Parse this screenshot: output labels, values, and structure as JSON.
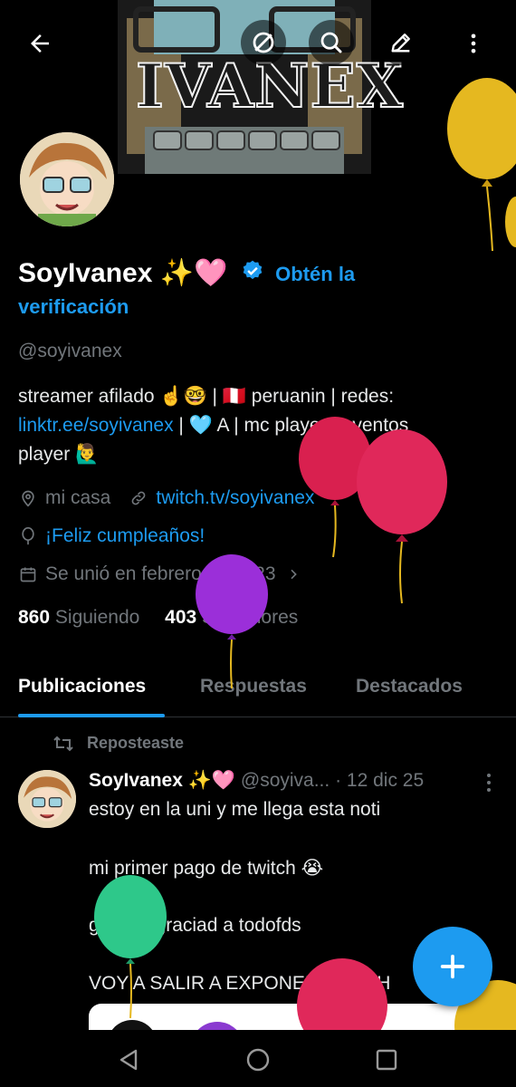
{
  "banner": {
    "logo_text": "IVANEX"
  },
  "topbar": {
    "icons": [
      "back-arrow-icon",
      "no-signal-icon",
      "search-icon",
      "edit-icon",
      "more-vertical-icon"
    ]
  },
  "profile": {
    "name": "SoyIvanex ✨🩷",
    "verify_text_1": "Obtén la",
    "verify_text_2": "verificación",
    "handle": "@soyivanex",
    "bio_1": "streamer afilado ☝️🤓 | 🇵🇪 peruanin | redes:",
    "bio_link": "linktr.ee/soyivanex",
    "bio_2": " | 🩵 A | mc player | eventos",
    "bio_3": "player 🙋‍♂️",
    "location": "mi casa",
    "website": "twitch.tv/soyivanex",
    "birthday": "¡Feliz cumpleaños!",
    "joined": "Se unió en febrero de 2023",
    "following_count": "860",
    "following_label": "Siguiendo",
    "followers_count": "403",
    "followers_label": "Seguidores"
  },
  "tabs": [
    "Publicaciones",
    "Respuestas",
    "Destacados"
  ],
  "post": {
    "repost_label": "Reposteaste",
    "author": "SoyIvanex ✨🩷",
    "handle": "@soyiva...",
    "date": "· 12 dic 25",
    "line_1": "estoy en la uni y me llega esta noti",
    "line_2": "mi primer pago de twitch 😭",
    "line_3": "gracias graciad a todofds",
    "line_4": "VOY A SALIR A EXPONER AHHHH"
  },
  "colors": {
    "accent": "#1d9bf0",
    "background": "#000000",
    "muted": "#71767b"
  }
}
